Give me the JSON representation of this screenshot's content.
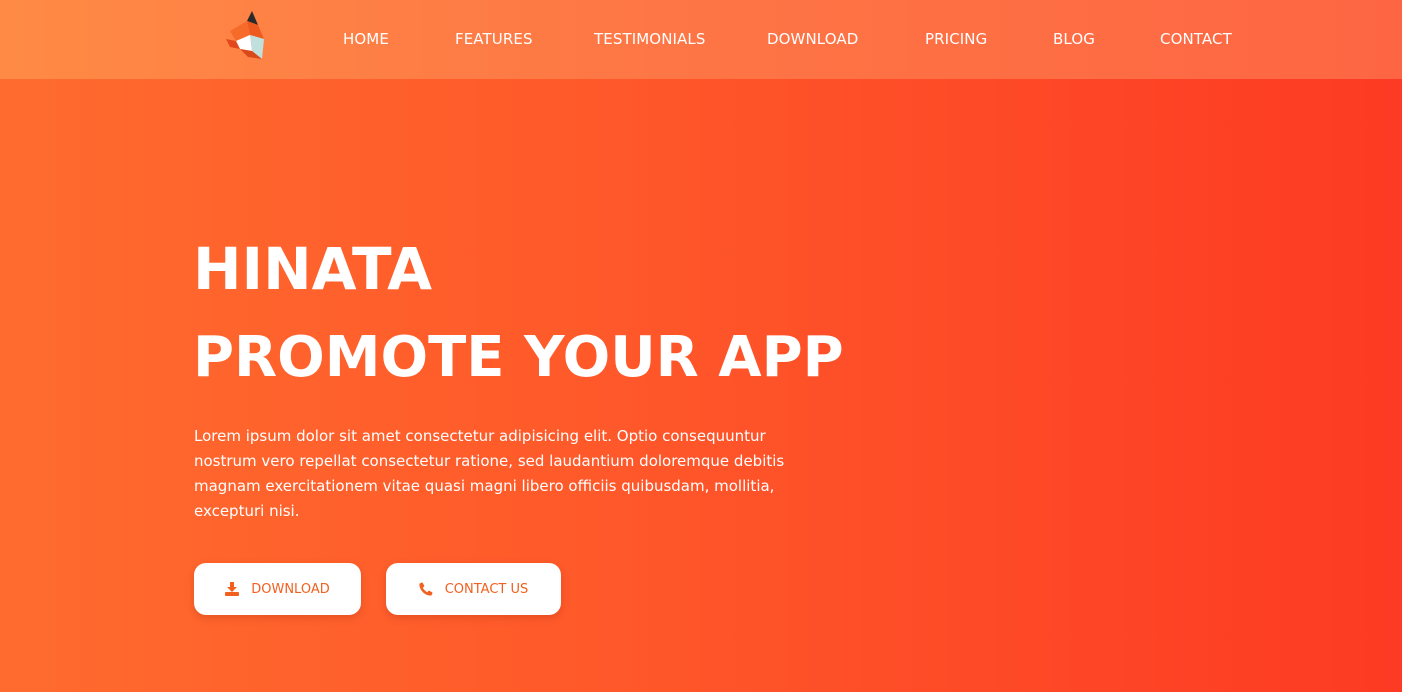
{
  "nav": {
    "logo_icon": "fox-logo-icon",
    "items": [
      {
        "label": "HOME"
      },
      {
        "label": "FEATURES"
      },
      {
        "label": "TESTIMONIALS"
      },
      {
        "label": "DOWNLOAD"
      },
      {
        "label": "PRICING"
      },
      {
        "label": "BLOG"
      },
      {
        "label": "CONTACT"
      }
    ]
  },
  "hero": {
    "title_line1": "HINATA",
    "title_line2": "PROMOTE YOUR APP",
    "description": "Lorem ipsum dolor sit amet consectetur adipisicing elit. Optio consequuntur nostrum vero repellat consectetur ratione, sed laudantium doloremque debitis magnam exercitationem vitae quasi magni libero officiis quibusdam, mollitia, excepturi nisi.",
    "buttons": {
      "download": {
        "label": "DOWNLOAD",
        "icon": "download-icon"
      },
      "contact": {
        "label": "CONTACT US",
        "icon": "phone-icon"
      }
    }
  },
  "colors": {
    "accent": "#f2601f",
    "gradient_start": "#ff6b2e",
    "gradient_end": "#fd3a23",
    "text": "#ffffff"
  }
}
